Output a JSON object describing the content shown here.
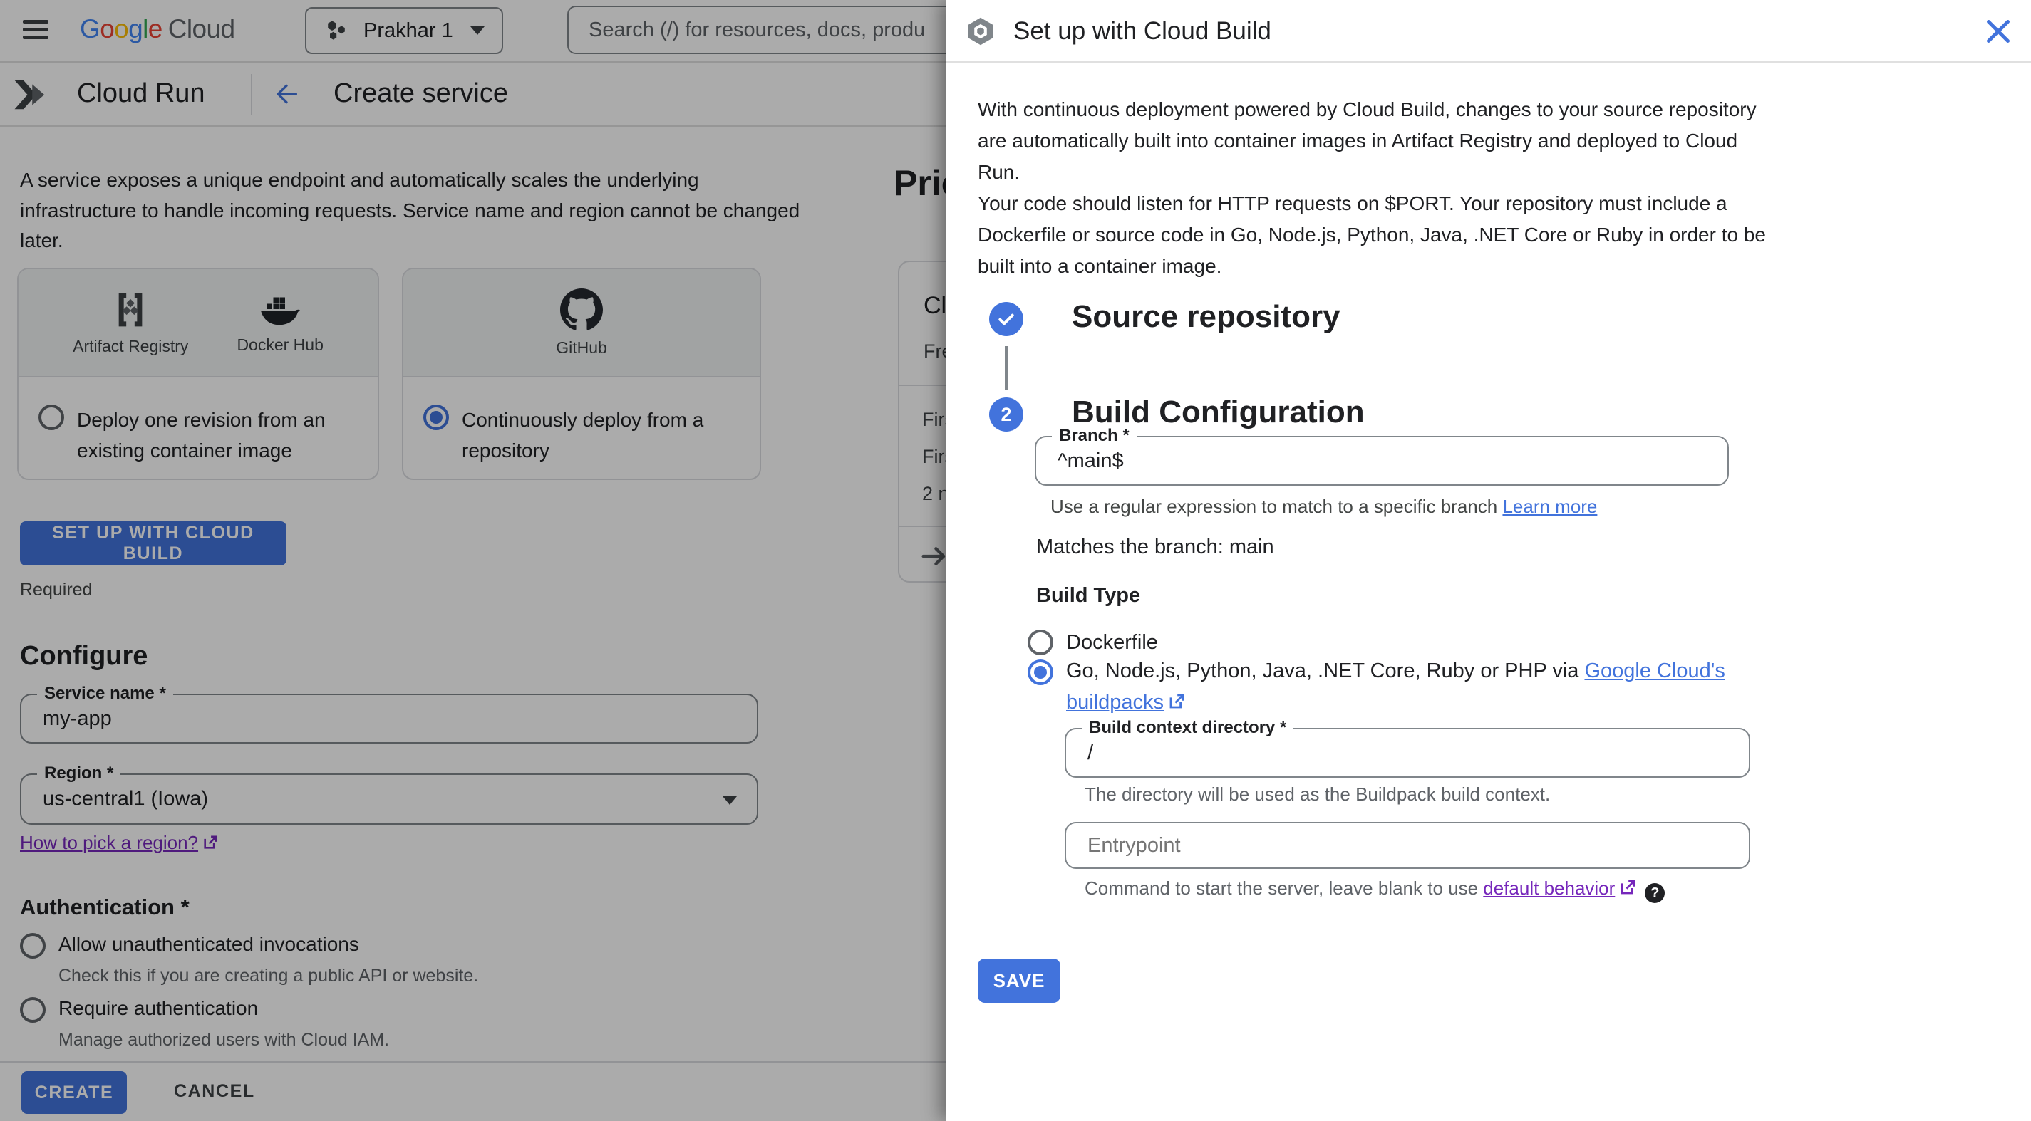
{
  "colors": {
    "accent": "#4273dc",
    "link_purple": "#7627bb",
    "text_primary": "#202124",
    "text_secondary": "#5f6368",
    "scrim": "rgba(0,0,0,0.33)",
    "card_header_bg": "#f1f3f4"
  },
  "topbar": {
    "logo_letters": [
      {
        "ch": "G",
        "color": "#4285F4"
      },
      {
        "ch": "o",
        "color": "#EA4335"
      },
      {
        "ch": "o",
        "color": "#FBBC05"
      },
      {
        "ch": "g",
        "color": "#4285F4"
      },
      {
        "ch": "l",
        "color": "#34A853"
      },
      {
        "ch": "e",
        "color": "#EA4335"
      }
    ],
    "logo_suffix": "Cloud",
    "project_name": "Prakhar 1",
    "search_placeholder": "Search (/) for resources, docs, produ"
  },
  "subheader": {
    "product": "Cloud Run",
    "page_title": "Create service"
  },
  "main": {
    "intro": "A service exposes a unique endpoint and automatically scales the underlying infrastructure to handle incoming requests. Service name and region cannot be changed later.",
    "cards": [
      {
        "sources": [
          {
            "label": "Artifact Registry"
          },
          {
            "label": "Docker Hub"
          }
        ],
        "option": "Deploy one revision from an existing container image"
      },
      {
        "sources": [
          {
            "label": "GitHub"
          }
        ],
        "option": "Continuously deploy from a repository"
      }
    ],
    "setup_button": "SET UP WITH CLOUD BUILD",
    "required_label": "Required",
    "configure": {
      "heading": "Configure",
      "service_name_label": "Service name *",
      "service_name_value": "my-app",
      "region_label": "Region *",
      "region_value": "us-central1 (Iowa)",
      "region_link": "How to pick a region?"
    },
    "authentication": {
      "heading": "Authentication *",
      "options": [
        {
          "label": "Allow unauthenticated invocations",
          "description": "Check this if you are creating a public API or website."
        },
        {
          "label": "Require authentication",
          "description": "Manage authorized users with Cloud IAM."
        }
      ]
    },
    "footer": {
      "create": "CREATE",
      "cancel": "CANCEL"
    }
  },
  "pricing_strip": {
    "heading_fragment": "Pric",
    "card_title_fragment": "Cl",
    "card_sub_fragment": "Fre",
    "row_fragments": [
      "Firs",
      "Firs",
      "2 n"
    ]
  },
  "panel": {
    "title": "Set up with Cloud Build",
    "intro_p1": "With continuous deployment powered by Cloud Build, changes to your source repository are automatically built into container images in Artifact Registry and deployed to Cloud Run.",
    "intro_p2": "Your code should listen for HTTP requests on $PORT. Your repository must include a Dockerfile or source code in Go, Node.js, Python, Java, .NET Core or Ruby in order to be built into a container image.",
    "steps": [
      {
        "title": "Source repository"
      },
      {
        "number": "2",
        "title": "Build Configuration"
      }
    ],
    "branch": {
      "label": "Branch *",
      "value": "^main$",
      "helper": "Use a regular expression to match to a specific branch ",
      "helper_link": "Learn more"
    },
    "matches": "Matches the branch: main",
    "build_type": {
      "heading": "Build Type",
      "option1": "Dockerfile",
      "option2_prefix": "Go, Node.js, Python, Java, .NET Core, Ruby or PHP via ",
      "option2_link1": "Google Cloud's",
      "option2_link2": "buildpacks"
    },
    "context_dir": {
      "label": "Build context directory *",
      "value": "/",
      "helper": "The directory will be used as the Buildpack build context."
    },
    "entrypoint": {
      "placeholder": "Entrypoint",
      "helper_prefix": "Command to start the server, leave blank to use ",
      "helper_link": "default behavior",
      "help_icon": "?"
    },
    "save": "SAVE"
  }
}
